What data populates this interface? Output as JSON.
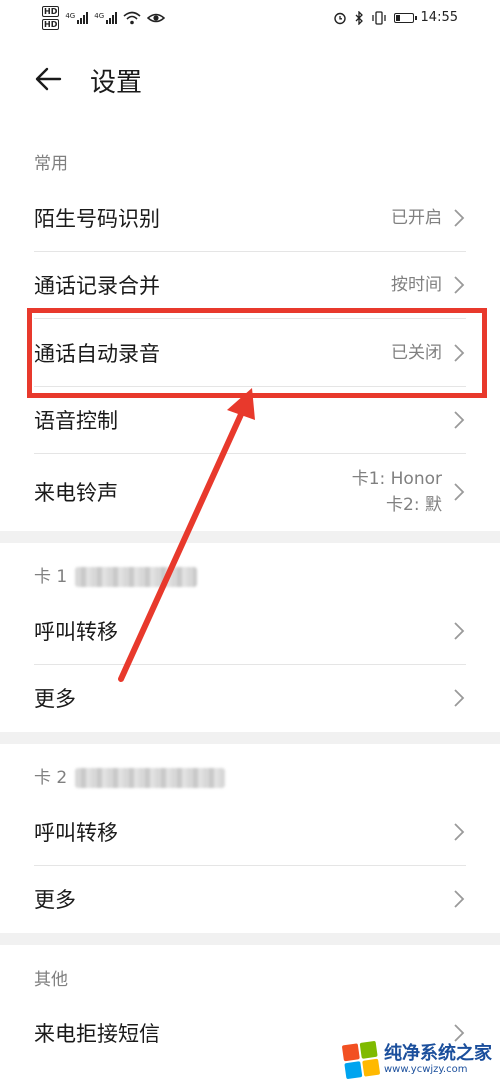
{
  "status_bar": {
    "hd1": "HD",
    "hd2": "HD",
    "sig1_label": "4G",
    "sig2_label": "4G",
    "time": "14:55",
    "battery_level": 0.3
  },
  "header": {
    "title": "设置"
  },
  "sections": {
    "common": {
      "title": "常用",
      "items": [
        {
          "label": "陌生号码识别",
          "value": "已开启"
        },
        {
          "label": "通话记录合并",
          "value": "按时间"
        },
        {
          "label": "通话自动录音",
          "value": "已关闭"
        },
        {
          "label": "语音控制",
          "value": ""
        },
        {
          "label": "来电铃声",
          "value_line1": "卡1: Honor",
          "value_line2": "卡2: 默"
        }
      ]
    },
    "card1": {
      "title": "卡 1",
      "items": [
        {
          "label": "呼叫转移"
        },
        {
          "label": "更多"
        }
      ]
    },
    "card2": {
      "title": "卡 2",
      "items": [
        {
          "label": "呼叫转移"
        },
        {
          "label": "更多"
        }
      ]
    },
    "other": {
      "title": "其他",
      "items": [
        {
          "label": "来电拒接短信"
        }
      ]
    }
  },
  "watermark": {
    "name": "纯净系统之家",
    "url": "www.ycwjzy.com"
  },
  "colors": {
    "highlight": "#e8392c",
    "secondary_text": "#808080",
    "divider": "#e5e5e5"
  }
}
